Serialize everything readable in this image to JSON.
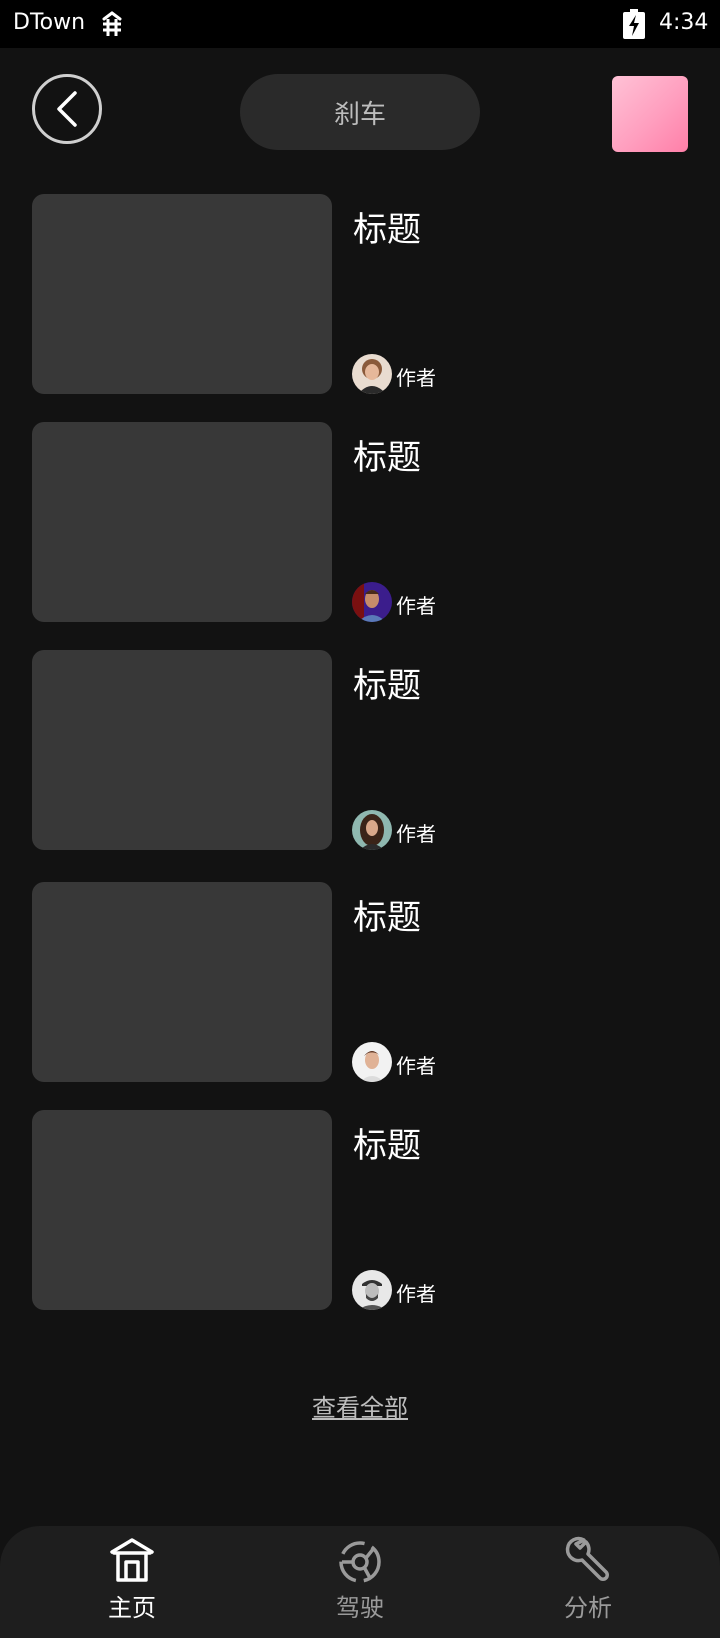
{
  "status_bar": {
    "app_name": "DTown",
    "time": "4:34"
  },
  "header": {
    "title": "刹车",
    "back_icon": "chevron-left-icon",
    "profile_color": "#ff9fbf"
  },
  "cards": [
    {
      "title": "标题",
      "author": "作者"
    },
    {
      "title": "标题",
      "author": "作者"
    },
    {
      "title": "标题",
      "author": "作者"
    },
    {
      "title": "标题",
      "author": "作者"
    },
    {
      "title": "标题",
      "author": "作者"
    }
  ],
  "view_all_label": "查看全部",
  "bottom_nav": {
    "items": [
      {
        "label": "主页",
        "icon": "home-icon",
        "active": true
      },
      {
        "label": "驾驶",
        "icon": "steering-wheel-icon",
        "active": false
      },
      {
        "label": "分析",
        "icon": "wrench-icon",
        "active": false
      }
    ]
  },
  "colors": {
    "background": "#121212",
    "card_placeholder": "#383838",
    "pill": "#2a2a2a",
    "nav_bar": "#1e1e1e"
  }
}
